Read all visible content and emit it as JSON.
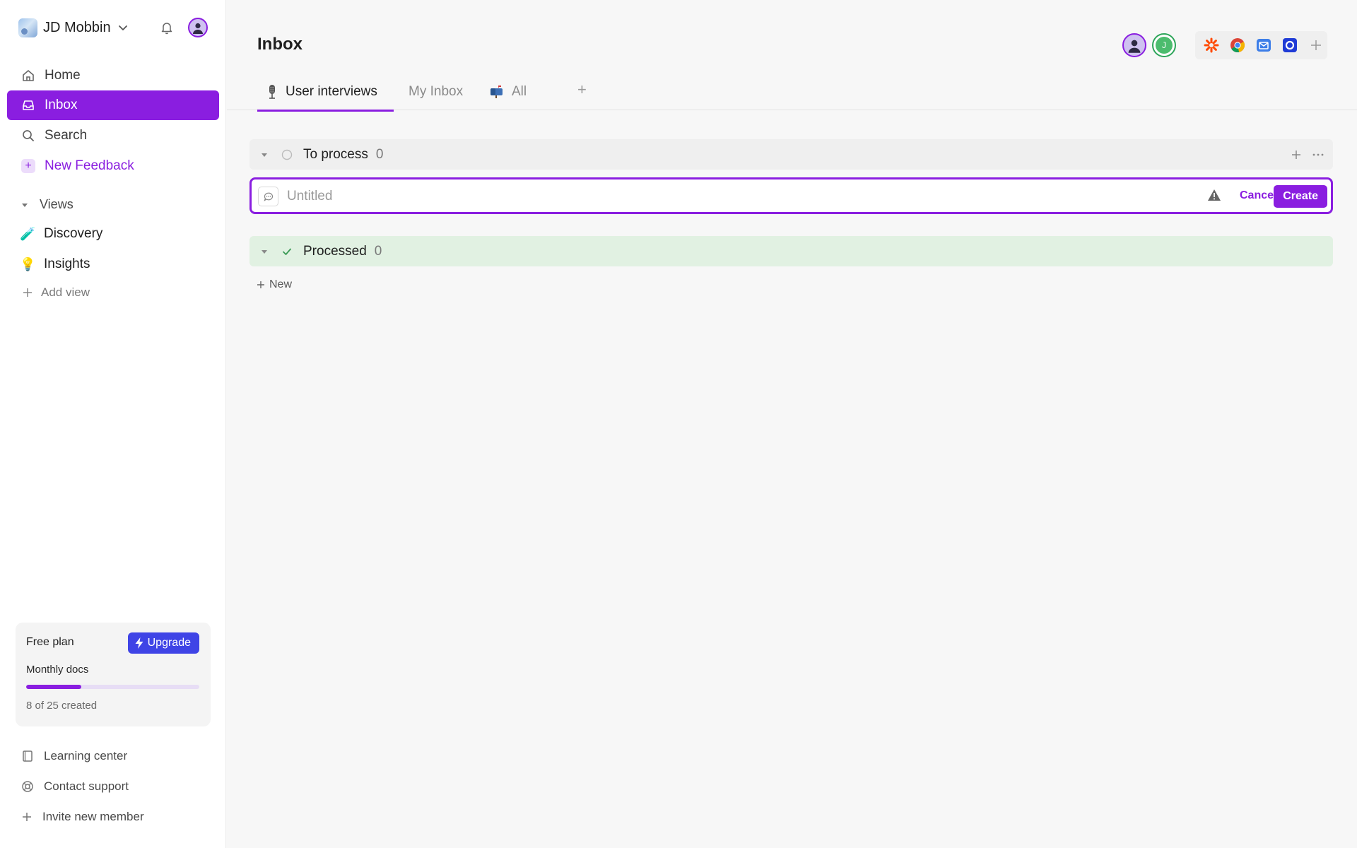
{
  "sidebar": {
    "workspace_name": "JD Mobbin",
    "nav": [
      {
        "label": "Home",
        "icon": "home-icon"
      },
      {
        "label": "Inbox",
        "icon": "inbox-icon"
      },
      {
        "label": "Search",
        "icon": "search-icon"
      },
      {
        "label": "New Feedback",
        "icon": "plus-icon"
      }
    ],
    "views_label": "Views",
    "views": [
      {
        "label": "Discovery",
        "icon": "test-tube-icon"
      },
      {
        "label": "Insights",
        "icon": "light-bulb-icon"
      }
    ],
    "add_view_label": "Add view",
    "plan": {
      "title": "Free plan",
      "upgrade_label": "Upgrade",
      "metric_label": "Monthly docs",
      "used": 8,
      "limit": 25,
      "count_text": "8 of 25 created"
    },
    "footer": [
      {
        "label": "Learning center",
        "icon": "book-icon"
      },
      {
        "label": "Contact support",
        "icon": "lifebuoy-icon"
      },
      {
        "label": "Invite new member",
        "icon": "plus-icon"
      }
    ]
  },
  "main": {
    "title": "Inbox",
    "collaborators": [
      {
        "initial": "",
        "color": "#8a1ee0"
      },
      {
        "initial": "J",
        "color": "#2ea55a"
      }
    ],
    "integrations": [
      "zapier-icon",
      "chrome-icon",
      "email-icon",
      "intercom-icon",
      "plus-icon"
    ],
    "tabs": [
      {
        "label": "User interviews",
        "icon": "microphone-icon",
        "active": true
      },
      {
        "label": "My Inbox",
        "active": false
      },
      {
        "label": "All",
        "icon": "mailbox-icon",
        "active": false
      }
    ],
    "groups": [
      {
        "name": "To process",
        "count": "0"
      },
      {
        "name": "Processed",
        "count": "0"
      }
    ],
    "new_item": {
      "placeholder": "Untitled",
      "cancel_label": "Cancel",
      "create_label": "Create"
    },
    "new_label": "New"
  },
  "colors": {
    "accent": "#8a1ee0",
    "upgrade": "#3f44e6",
    "processed_bg": "#e1f1e2"
  }
}
